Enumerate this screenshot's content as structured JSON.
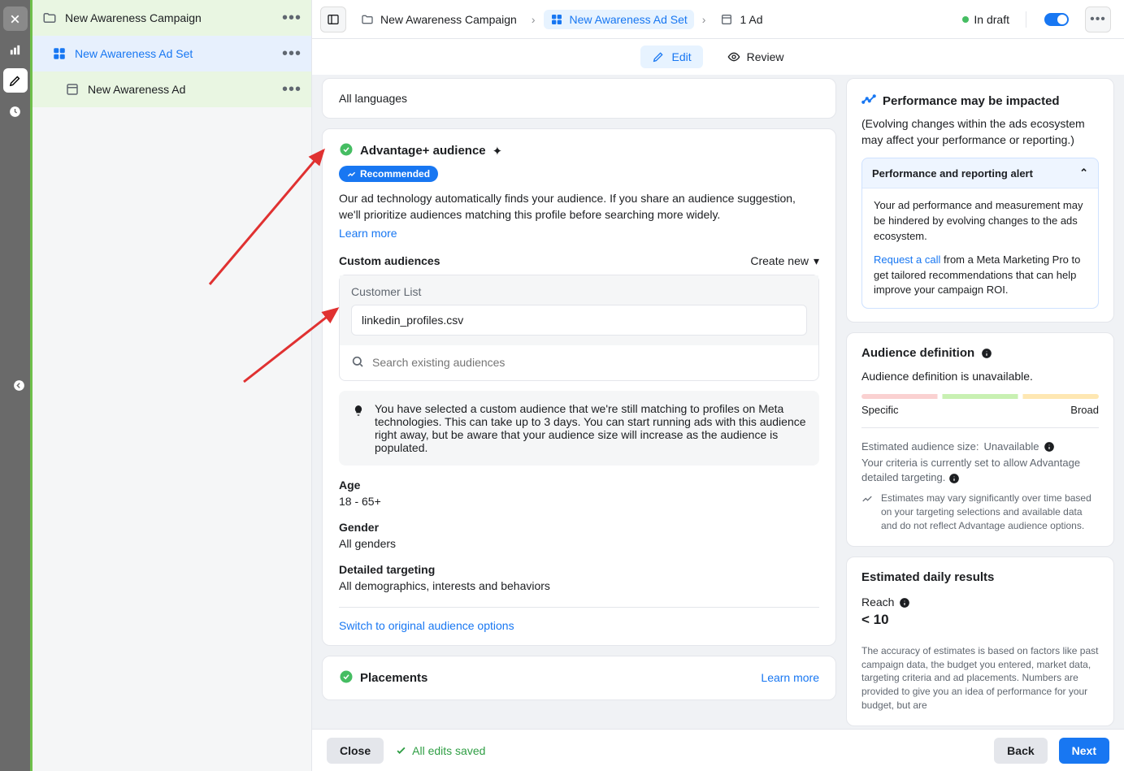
{
  "rail": {
    "expand": "expand"
  },
  "tree": {
    "campaign": "New Awareness Campaign",
    "adset": "New Awareness Ad Set",
    "ad": "New Awareness Ad"
  },
  "breadcrumb": {
    "campaign": "New Awareness Campaign",
    "adset": "New Awareness Ad Set",
    "ad": "1 Ad",
    "status": "In draft"
  },
  "tabs": {
    "edit": "Edit",
    "review": "Review"
  },
  "languages": {
    "value": "All languages"
  },
  "audience": {
    "title": "Advantage+ audience",
    "badge": "Recommended",
    "desc": "Our ad technology automatically finds your audience. If you share an audience suggestion, we'll prioritize audiences matching this profile before searching more widely.",
    "learn": "Learn more",
    "customLabel": "Custom audiences",
    "createNew": "Create new",
    "listTitle": "Customer List",
    "listFile": "linkedin_profiles.csv",
    "searchPlaceholder": "Search existing audiences",
    "info": "You have selected a custom audience that we're still matching to profiles on Meta technologies. This can take up to 3 days. You can start running ads with this audience right away, but be aware that your audience size will increase as the audience is populated.",
    "ageLabel": "Age",
    "ageValue": "18 - 65+",
    "genderLabel": "Gender",
    "genderValue": "All genders",
    "dtLabel": "Detailed targeting",
    "dtValue": "All demographics, interests and behaviors",
    "switch": "Switch to original audience options"
  },
  "placements": {
    "title": "Placements",
    "learn": "Learn more"
  },
  "rightPerf": {
    "title": "Performance may be impacted",
    "sub": "(Evolving changes within the ads ecosystem may affect your performance or reporting.)",
    "alertHead": "Performance and reporting alert",
    "alertBody1": "Your ad performance and measurement may be hindered by evolving changes to the ads ecosystem.",
    "requestCall": "Request a call",
    "alertBody2": " from a Meta Marketing Pro to get tailored recommendations that can help improve your campaign ROI."
  },
  "audDef": {
    "title": "Audience definition",
    "unavailable": "Audience definition is unavailable.",
    "specific": "Specific",
    "broad": "Broad",
    "sizeLabel": "Estimated audience size:",
    "sizeValue": "Unavailable",
    "criteria": "Your criteria is currently set to allow Advantage detailed targeting.",
    "estNote": "Estimates may vary significantly over time based on your targeting selections and available data and do not reflect Advantage audience options."
  },
  "daily": {
    "title": "Estimated daily results",
    "reachLabel": "Reach",
    "reachValue": "< 10",
    "disclaimer": "The accuracy of estimates is based on factors like past campaign data, the budget you entered, market data, targeting criteria and ad placements. Numbers are provided to give you an idea of performance for your budget, but are"
  },
  "footer": {
    "close": "Close",
    "saved": "All edits saved",
    "back": "Back",
    "next": "Next"
  }
}
